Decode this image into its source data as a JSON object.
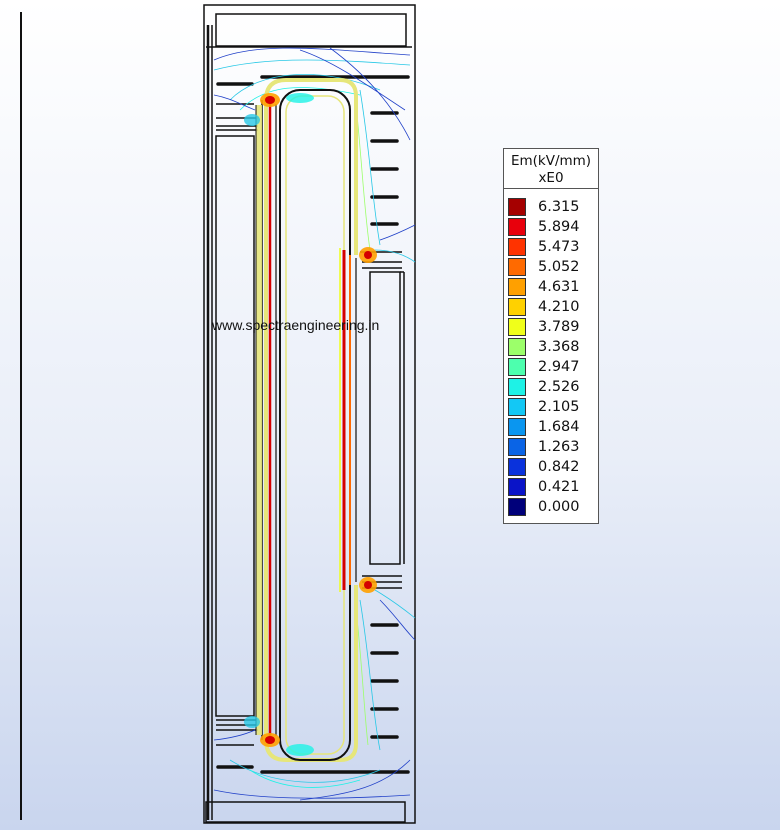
{
  "legend": {
    "title_line1": "Em(kV/mm)",
    "title_line2": "xE0",
    "items": [
      {
        "value": "6.315",
        "color": "#a50000"
      },
      {
        "value": "5.894",
        "color": "#e8000c"
      },
      {
        "value": "5.473",
        "color": "#ff3300"
      },
      {
        "value": "5.052",
        "color": "#ff6a00"
      },
      {
        "value": "4.631",
        "color": "#ffa000"
      },
      {
        "value": "4.210",
        "color": "#ffd100"
      },
      {
        "value": "3.789",
        "color": "#f0ff1a"
      },
      {
        "value": "3.368",
        "color": "#9cff6a"
      },
      {
        "value": "2.947",
        "color": "#4dffae"
      },
      {
        "value": "2.526",
        "color": "#1ef2e6"
      },
      {
        "value": "2.105",
        "color": "#13c8f5"
      },
      {
        "value": "1.684",
        "color": "#0a96f0"
      },
      {
        "value": "1.263",
        "color": "#0a64e6"
      },
      {
        "value": "0.842",
        "color": "#0a32dc"
      },
      {
        "value": "0.421",
        "color": "#0a14c8"
      },
      {
        "value": "0.000",
        "color": "#00007a"
      }
    ]
  },
  "watermark": "www.spectraengineering.in",
  "colors": {
    "structure": "#111111",
    "high_field": "#d40000",
    "mid_field": "#e6e67a",
    "contour_cyan": "#28c8e6",
    "contour_blue": "#2040c8"
  }
}
